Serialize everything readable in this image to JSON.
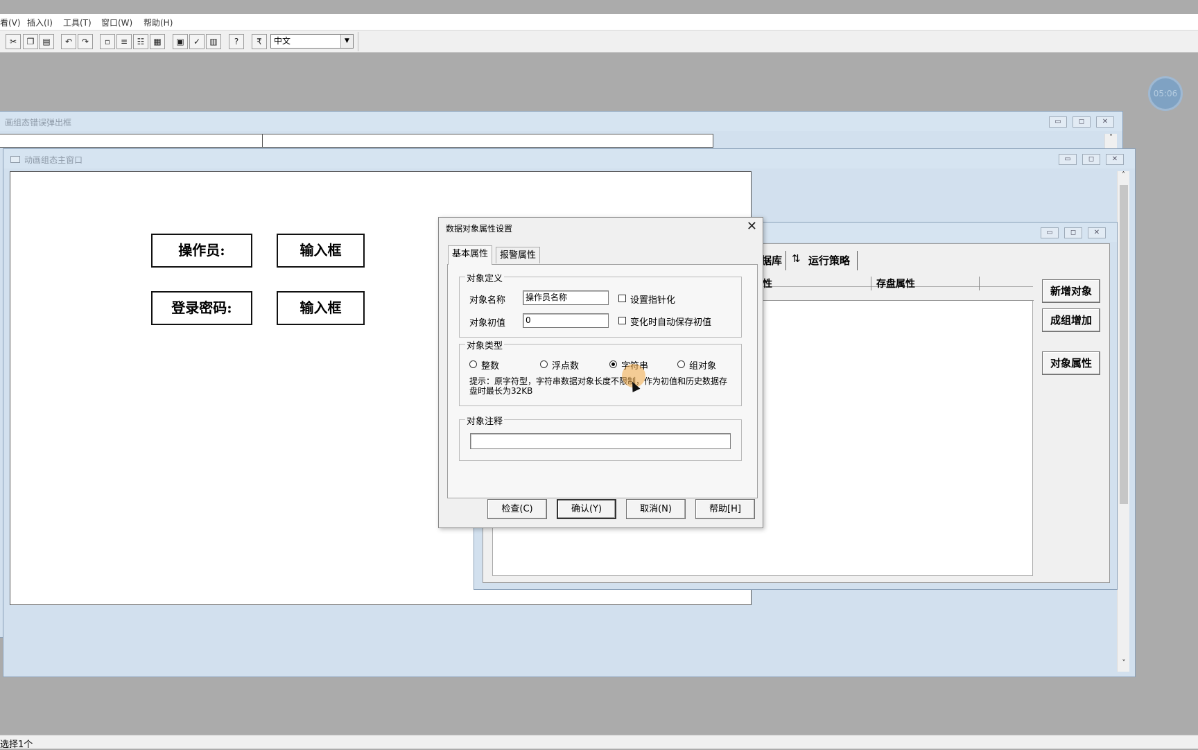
{
  "menu": {
    "view": "看(V)",
    "insert": "插入(I)",
    "tools": "工具(T)",
    "window": "窗口(W)",
    "help": "帮助(H)"
  },
  "toolbar": {
    "language_value": "中文"
  },
  "timer": "05:06",
  "windows": {
    "error_popup_title": "画组态错误弹出框",
    "main_window_title": "动画组态主窗口"
  },
  "canvas": {
    "operator_label": "操作员:",
    "input_box_1": "输入框",
    "password_label": "登录密码:",
    "input_box_2": "输入框"
  },
  "workspace": {
    "tab_partial": "据库",
    "tab_run_strategy": "运行策略",
    "col_partial": "性",
    "col_storage": "存盘属性",
    "btn_new_object": "新增对象",
    "btn_group_add": "成组增加",
    "btn_object_props": "对象属性"
  },
  "dialog": {
    "title": "数据对象属性设置",
    "close": "✕",
    "tab_basic": "基本属性",
    "tab_alarm": "报警属性",
    "group_definition": "对象定义",
    "name_label": "对象名称",
    "name_value": "操作员名称",
    "initial_label": "对象初值",
    "initial_value": "0",
    "chk_pointer": "设置指针化",
    "chk_autosave": "变化时自动保存初值",
    "group_type": "对象类型",
    "type_integer": "整数",
    "type_float": "浮点数",
    "type_string": "字符串",
    "type_group": "组对象",
    "hint": "提示：原字符型，字符串数据对象长度不限制，作为初值和历史数据存盘时最长为32KB",
    "group_comment": "对象注释",
    "comment_value": "",
    "btn_check": "检查(C)",
    "btn_ok": "确认(Y)",
    "btn_cancel": "取消(N)",
    "btn_help": "帮助[H]"
  },
  "status": {
    "selection": "选择1个"
  }
}
